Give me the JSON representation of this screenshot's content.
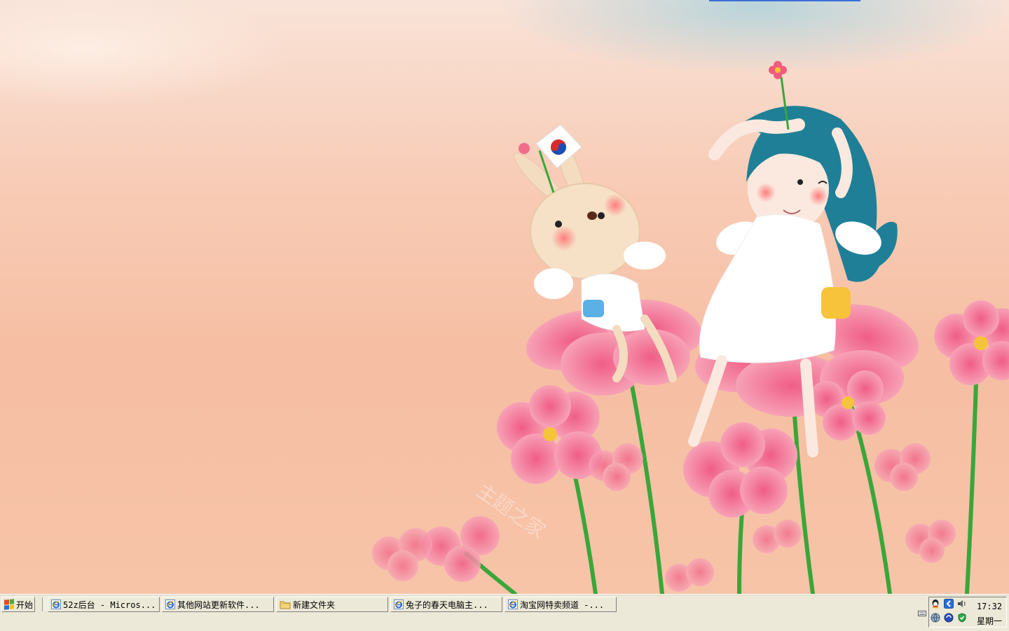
{
  "colors": {
    "taskbar_bg": "#ece9d8",
    "wallpaper_top": "#f9e3d8",
    "wallpaper_bottom": "#f7c4a8",
    "flower_pink": "#f37d9a",
    "stem_green": "#3aa63a",
    "hair_teal": "#1f7f97"
  },
  "taskbar": {
    "start_label": "开始",
    "buttons": [
      {
        "label": "52z后台 - Micros...",
        "icon": "ie-icon"
      },
      {
        "label": "其他网站更新软件...",
        "icon": "ie-icon"
      },
      {
        "label": "新建文件夹",
        "icon": "folder-icon"
      },
      {
        "label": "兔子的春天电脑主...",
        "icon": "ie-icon"
      },
      {
        "label": "淘宝网特卖频道 -...",
        "icon": "ie-icon"
      }
    ]
  },
  "tray": {
    "icons": [
      "qq-icon",
      "network-back-icon",
      "speaker-icon",
      "globe-icon",
      "browser-icon",
      "shield-icon"
    ],
    "time": "17:32",
    "day": "星期一"
  },
  "wallpaper": {
    "description_icon": "wallpaper-illustration",
    "watermark": "主题之家"
  }
}
